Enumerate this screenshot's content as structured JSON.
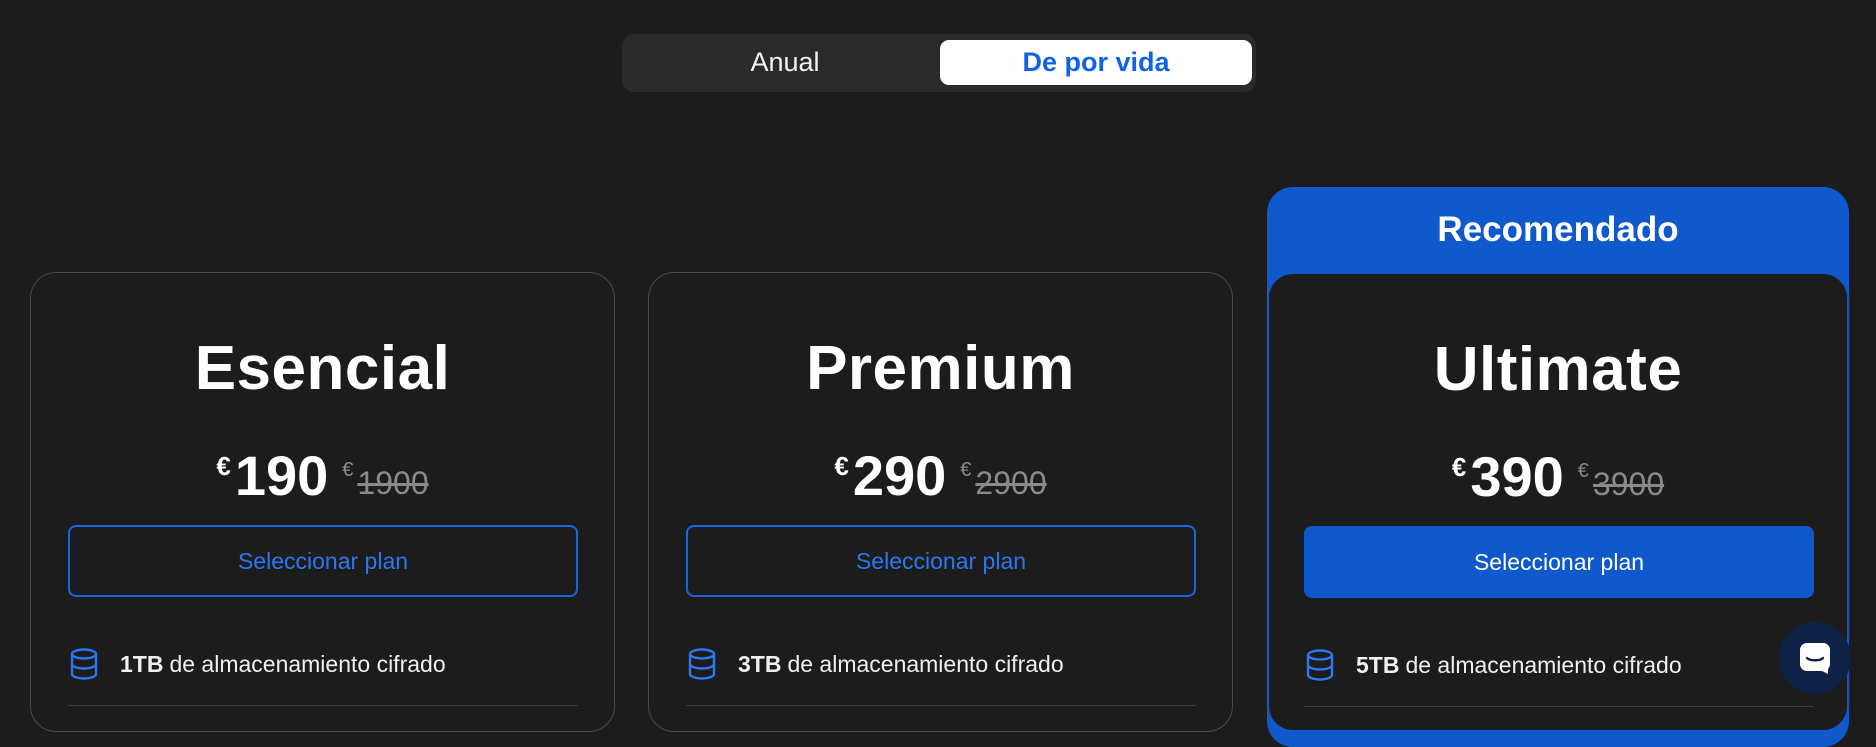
{
  "billing_toggle": {
    "options": [
      "Anual",
      "De por vida"
    ],
    "selected": "De por vida"
  },
  "recommended_label": "Recomendado",
  "plans": [
    {
      "name": "Esencial",
      "currency": "€",
      "price": "190",
      "old_currency": "€",
      "old_price": "1900",
      "button_label": "Seleccionar plan",
      "feature_strong": "1TB",
      "feature_text": "de almacenamiento cifrado"
    },
    {
      "name": "Premium",
      "currency": "€",
      "price": "290",
      "old_currency": "€",
      "old_price": "2900",
      "button_label": "Seleccionar plan",
      "feature_strong": "3TB",
      "feature_text": "de almacenamiento cifrado"
    },
    {
      "name": "Ultimate",
      "currency": "€",
      "price": "390",
      "old_currency": "€",
      "old_price": "3900",
      "button_label": "Seleccionar plan",
      "feature_strong": "5TB",
      "feature_text": "de almacenamiento cifrado",
      "recommended": true
    }
  ],
  "icons": {
    "feature": "database-icon",
    "chat": "chat-icon"
  },
  "colors": {
    "background": "#1c1c1c",
    "accent": "#1059cc",
    "accent_text": "#2b78f0",
    "toggle_bg": "#2a2a2a"
  }
}
